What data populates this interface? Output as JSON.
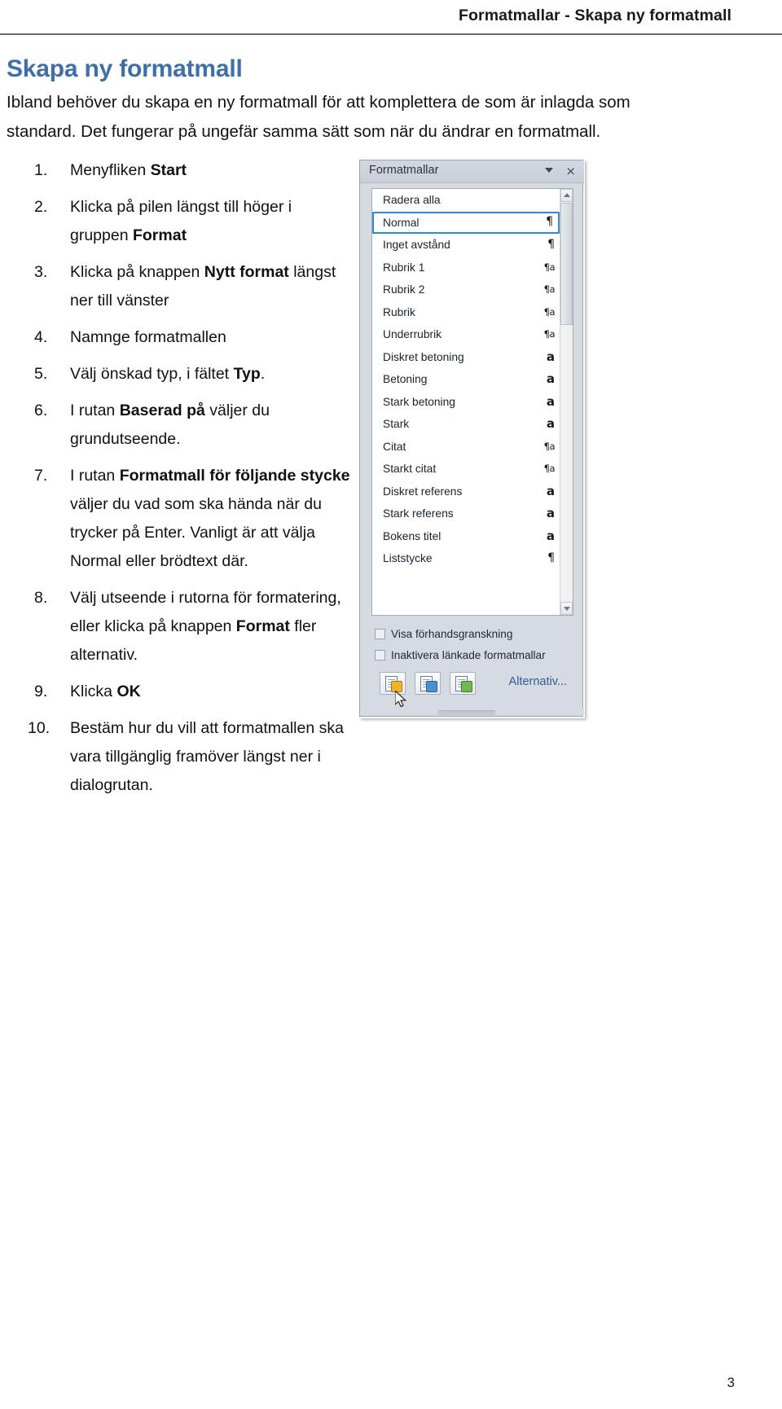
{
  "header": {
    "running_head": "Formatmallar - Skapa ny formatmall"
  },
  "title": "Skapa ny formatmall",
  "intro": "Ibland behöver du skapa en ny formatmall för att komplettera de som är inlagda som standard. Det fungerar på ungefär samma sätt som när du ändrar en formatmall.",
  "steps": [
    {
      "num": "1.",
      "html": "Menyfliken <b>Start</b>"
    },
    {
      "num": "2.",
      "html": "Klicka på pilen längst till höger i gruppen <b>Format</b>"
    },
    {
      "num": "3.",
      "html": "Klicka på knappen <b>Nytt format</b> längst ner till vänster"
    },
    {
      "num": "4.",
      "html": "Namnge formatmallen"
    },
    {
      "num": "5.",
      "html": "Välj önskad typ, i fältet <b>Typ</b>."
    },
    {
      "num": "6.",
      "html": "I rutan <b>Baserad på</b> väljer du grundutseende."
    },
    {
      "num": "7.",
      "html": "I rutan <b>Formatmall för följande stycke</b> väljer du vad som ska hända när du trycker på Enter. Vanligt är att välja Normal eller brödtext där."
    },
    {
      "num": "8.",
      "html": "Välj utseende i rutorna för formatering, eller klicka på knappen <b>Format</b> fler alternativ."
    },
    {
      "num": "9.",
      "html": "Klicka <b>OK</b>"
    },
    {
      "num": "10.",
      "html": "Bestäm hur du vill att formatmallen ska vara tillgänglig framöver längst ner i dialogrutan."
    }
  ],
  "pane": {
    "title": "Formatmallar",
    "caret_icon": "chevron-down-icon",
    "close_icon": "×",
    "styles": [
      {
        "name": "Radera alla",
        "glyph": "",
        "glyph_kind": "none",
        "selected": false
      },
      {
        "name": "Normal",
        "glyph": "¶",
        "glyph_kind": "paragraph",
        "selected": true
      },
      {
        "name": "Inget avstånd",
        "glyph": "¶",
        "glyph_kind": "paragraph",
        "selected": false
      },
      {
        "name": "Rubrik 1",
        "glyph": "¶a",
        "glyph_kind": "linked",
        "selected": false
      },
      {
        "name": "Rubrik 2",
        "glyph": "¶a",
        "glyph_kind": "linked",
        "selected": false
      },
      {
        "name": "Rubrik",
        "glyph": "¶a",
        "glyph_kind": "linked",
        "selected": false
      },
      {
        "name": "Underrubrik",
        "glyph": "¶a",
        "glyph_kind": "linked",
        "selected": false
      },
      {
        "name": "Diskret betoning",
        "glyph": "a",
        "glyph_kind": "character",
        "selected": false
      },
      {
        "name": "Betoning",
        "glyph": "a",
        "glyph_kind": "character",
        "selected": false
      },
      {
        "name": "Stark betoning",
        "glyph": "a",
        "glyph_kind": "character",
        "selected": false
      },
      {
        "name": "Stark",
        "glyph": "a",
        "glyph_kind": "character",
        "selected": false
      },
      {
        "name": "Citat",
        "glyph": "¶a",
        "glyph_kind": "linked",
        "selected": false
      },
      {
        "name": "Starkt citat",
        "glyph": "¶a",
        "glyph_kind": "linked",
        "selected": false
      },
      {
        "name": "Diskret referens",
        "glyph": "a",
        "glyph_kind": "character",
        "selected": false
      },
      {
        "name": "Stark referens",
        "glyph": "a",
        "glyph_kind": "character",
        "selected": false
      },
      {
        "name": "Bokens titel",
        "glyph": "a",
        "glyph_kind": "character",
        "selected": false
      },
      {
        "name": "Liststycke",
        "glyph": "¶",
        "glyph_kind": "paragraph",
        "selected": false
      }
    ],
    "checkboxes": [
      {
        "label": "Visa förhandsgranskning",
        "checked": false
      },
      {
        "label": "Inaktivera länkade formatmallar",
        "checked": false
      }
    ],
    "buttons": [
      {
        "name": "new-style-button",
        "badge": "yellow"
      },
      {
        "name": "style-inspector-button",
        "badge": "blue"
      },
      {
        "name": "manage-styles-button",
        "badge": "green"
      }
    ],
    "options_link": "Alternativ..."
  },
  "page_number": "3",
  "colors": {
    "heading": "#3f6fa8",
    "selection": "#2e8bdc",
    "pane_bg": "#d6dbe3",
    "link": "#2f5c96"
  }
}
